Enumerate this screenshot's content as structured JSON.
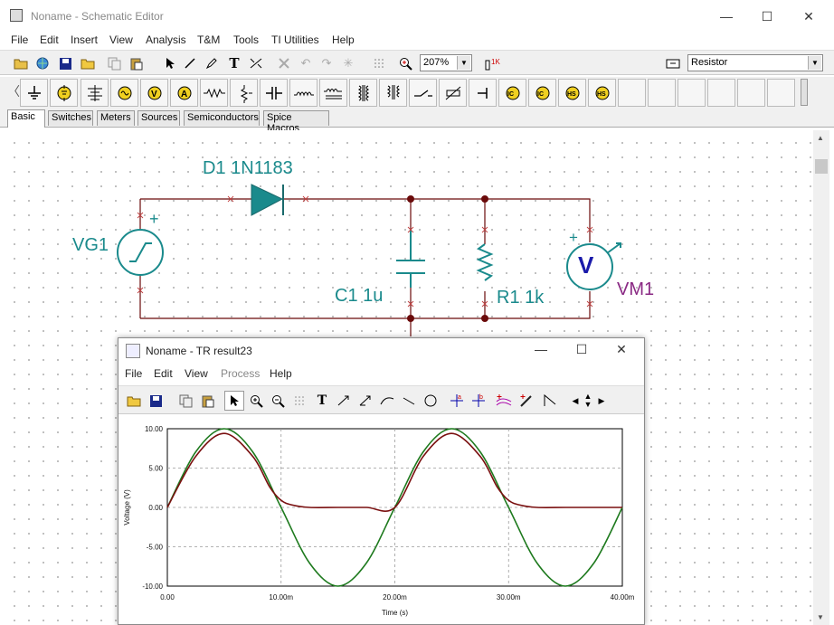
{
  "window": {
    "title": "Noname - Schematic Editor",
    "minimize": "—",
    "maximize": "☐",
    "close": "✕"
  },
  "menu": [
    "File",
    "Edit",
    "Insert",
    "View",
    "Analysis",
    "T&M",
    "Tools",
    "TI Utilities",
    "Help"
  ],
  "toolbar": {
    "zoom": "207%",
    "component": "Resistor"
  },
  "palette_tabs": [
    "Basic",
    "Switches",
    "Meters",
    "Sources",
    "Semiconductors",
    "Spice Macros"
  ],
  "active_tab": "Basic",
  "schematic": {
    "diode_label": "D1 1N1183",
    "source_label": "VG1",
    "capacitor_label": "C1 1u",
    "resistor_label": "R1 1k",
    "meter_label": "VM1",
    "meter_symbol": "V",
    "plus_sign": "+"
  },
  "result_window": {
    "title": "Noname - TR result23",
    "menu": [
      "File",
      "Edit",
      "View",
      "Process",
      "Help"
    ],
    "disabled_menu": "Process"
  },
  "chart_data": {
    "type": "line",
    "title": "",
    "xlabel": "Time (s)",
    "ylabel": "Voltage (V)",
    "xlim": [
      0,
      0.04
    ],
    "ylim": [
      -10,
      10
    ],
    "x_ticks": [
      "0.00",
      "10.00m",
      "20.00m",
      "30.00m",
      "40.00m"
    ],
    "y_ticks": [
      "10.00",
      "5.00",
      "0.00",
      "-5.00",
      "-10.00"
    ],
    "grid": true,
    "series": [
      {
        "color": "#1e7a1e",
        "x": [
          0,
          0.0025,
          0.005,
          0.0075,
          0.01,
          0.0125,
          0.015,
          0.0175,
          0.02,
          0.0225,
          0.025,
          0.0275,
          0.03,
          0.0325,
          0.035,
          0.0375,
          0.04
        ],
        "y": [
          0,
          7.07,
          10,
          7.07,
          0,
          -7.07,
          -10,
          -7.07,
          0,
          7.07,
          10,
          7.07,
          0,
          -7.07,
          -10,
          -7.07,
          0
        ]
      },
      {
        "color": "#7a1010",
        "x": [
          0,
          0.0025,
          0.005,
          0.0075,
          0.009,
          0.01,
          0.011,
          0.0125,
          0.015,
          0.0175,
          0.02,
          0.0225,
          0.025,
          0.0275,
          0.029,
          0.03,
          0.031,
          0.0325,
          0.035,
          0.0375,
          0.04
        ],
        "y": [
          0,
          6.5,
          9.4,
          6.5,
          2.6,
          0.9,
          0.3,
          0,
          0,
          0,
          0,
          6.5,
          9.4,
          6.5,
          2.6,
          0.9,
          0.3,
          0,
          0,
          0,
          0
        ]
      }
    ]
  }
}
